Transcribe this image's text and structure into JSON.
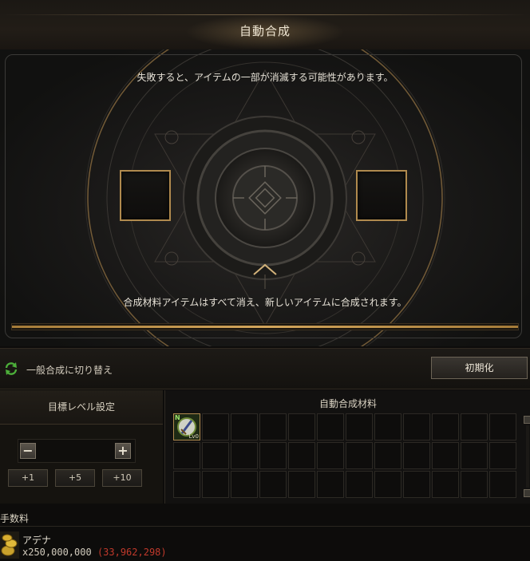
{
  "header": {
    "title": "自動合成"
  },
  "stage": {
    "warning": "失敗すると、アイテムの一部が消滅する可能性があります。",
    "info": "合成材料アイテムはすべて消え、新しいアイテムに合成されます。",
    "progress": 1.0
  },
  "toggle": {
    "switch_label": "一般合成に切り替え",
    "reset_label": "初期化"
  },
  "target_level": {
    "title": "目標レベル設定",
    "minus_label": "−",
    "plus_label": "+",
    "increments": [
      "+1",
      "+5",
      "+10"
    ]
  },
  "materials": {
    "title": "自動合成材料",
    "columns": 12,
    "rows": 3,
    "items": [
      {
        "slot": 0,
        "badge": "N",
        "level": "Lv0"
      }
    ]
  },
  "fee": {
    "label": "手数料",
    "currency_name": "アデナ",
    "cost": "x250,000,000",
    "owned": "(33,962,298)"
  },
  "colors": {
    "accent_gold": "#b08a4e",
    "insufficient_red": "#c0392b",
    "switch_green": "#4caf3a"
  }
}
